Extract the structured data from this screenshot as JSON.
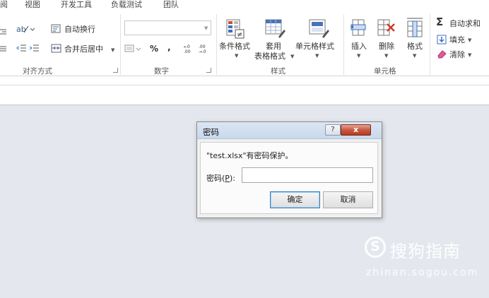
{
  "tabs": [
    "阅",
    "视图",
    "开发工具",
    "负载测试",
    "团队"
  ],
  "alignment": {
    "wrap_text": "自动换行",
    "merge_center": "合并后居中",
    "group_label": "对齐方式"
  },
  "number": {
    "format_value": "",
    "percent": "%",
    "comma": ",",
    "group_label": "数字"
  },
  "styles": {
    "conditional_format": "条件格式",
    "table_format_line1": "套用",
    "table_format_line2": "表格格式",
    "cell_styles": "单元格样式",
    "group_label": "样式"
  },
  "cells": {
    "insert": "插入",
    "delete": "删除",
    "format": "格式",
    "group_label": "单元格"
  },
  "editing": {
    "autosum": "自动求和",
    "fill": "填充",
    "clear": "清除"
  },
  "dialog": {
    "title": "密码",
    "help": "?",
    "close": "x",
    "message": "\"test.xlsx\"有密码保护。",
    "password_label_prefix": "密码(",
    "password_label_key": "P",
    "password_label_suffix": "):",
    "password_value": "",
    "ok": "确定",
    "cancel": "取消"
  },
  "watermark": {
    "logo": "S",
    "text": "搜狗指南",
    "url": "zhinan.sogou.com"
  }
}
